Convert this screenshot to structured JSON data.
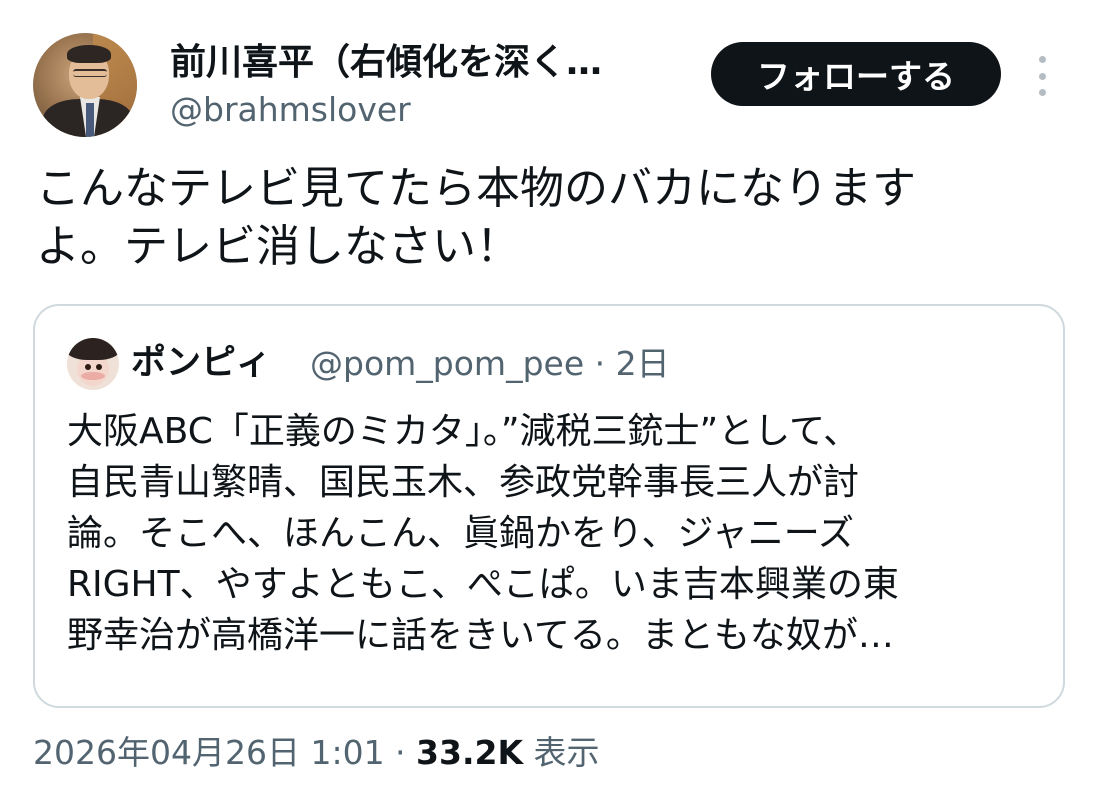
{
  "author": {
    "display_name": "前川喜平（右傾化を深く…",
    "handle": "@brahmslover"
  },
  "follow_button": {
    "label": "フォローする"
  },
  "more_icon": "more-vertical-icon",
  "tweet": {
    "text_lines": [
      "こんなテレビ見てたら本物のバカになります",
      "よ。テレビ消しなさい！"
    ]
  },
  "quoted": {
    "display_name": "ポンピィ",
    "meta": "@pom_pom_pee · 2日",
    "text_lines": [
      "大阪ABC「正義のミカタ」。”減税三銃士”として、",
      "自民青山繁晴、国民玉木、参政党幹事長三人が討",
      "論。そこへ、ほんこん、眞鍋かをり、ジャニーズ",
      "RIGHT、やすよともこ、ぺこぱ。いま吉本興業の東",
      "野幸治が高橋洋一に話をきいてる。まともな奴が…"
    ]
  },
  "footer": {
    "timestamp": "2026年04月26日 1:01 · ",
    "views_count": "33.2K",
    "views_label": " 表示"
  },
  "colors": {
    "text_primary": "#0f1419",
    "text_secondary": "#536471",
    "border": "#cfd9de",
    "button_bg": "#0f1419",
    "button_text": "#ffffff"
  }
}
